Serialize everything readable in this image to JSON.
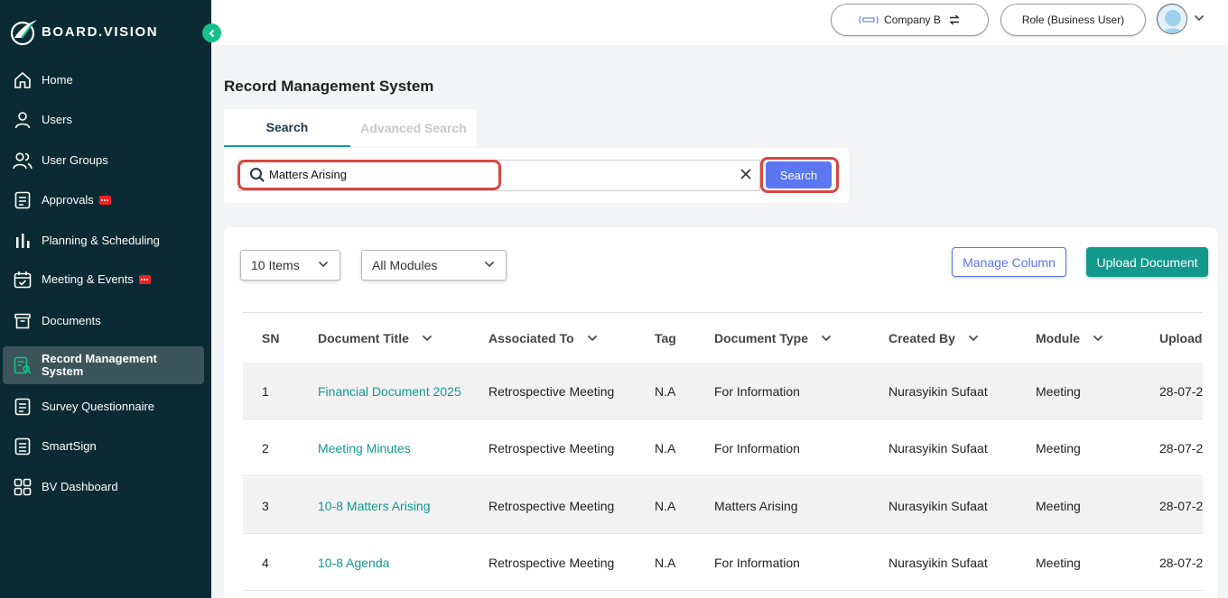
{
  "brand": {
    "name": "BOARD.VISION"
  },
  "sidebar": {
    "items": [
      {
        "label": "Home",
        "icon": "home-icon"
      },
      {
        "label": "Users",
        "icon": "user-icon"
      },
      {
        "label": "User Groups",
        "icon": "user-groups-icon"
      },
      {
        "label": "Approvals",
        "icon": "approvals-icon",
        "badge": true
      },
      {
        "label": "Planning & Scheduling",
        "icon": "bar-chart-icon"
      },
      {
        "label": "Meeting & Events",
        "icon": "calendar-icon",
        "badge": true
      },
      {
        "label": "Documents",
        "icon": "archive-icon"
      },
      {
        "label": "Record Management System",
        "icon": "record-icon",
        "active": true
      },
      {
        "label": "Survey Questionnaire",
        "icon": "survey-icon"
      },
      {
        "label": "SmartSign",
        "icon": "smartsign-icon"
      },
      {
        "label": "BV Dashboard",
        "icon": "dashboard-grid-icon"
      }
    ]
  },
  "topbar": {
    "company_label": "Company B",
    "role_label": "Role (Business User)"
  },
  "page": {
    "title": "Record Management System"
  },
  "tabs": {
    "search": "Search",
    "advanced": "Advanced Search"
  },
  "search": {
    "value": "Matters Arising",
    "button_label": "Search"
  },
  "toolbar": {
    "items_select": "10 Items",
    "modules_select": "All Modules",
    "manage_column": "Manage Column",
    "upload_document": "Upload Document"
  },
  "table": {
    "columns": [
      "SN",
      "Document Title",
      "Associated To",
      "Tag",
      "Document Type",
      "Created By",
      "Module",
      "Upload"
    ],
    "rows": [
      [
        "1",
        "Financial Document 2025",
        "Retrospective Meeting",
        "N.A",
        "For Information",
        "Nurasyikin Sufaat",
        "Meeting",
        "28-07-2"
      ],
      [
        "2",
        "Meeting Minutes",
        "Retrospective Meeting",
        "N.A",
        "For Information",
        "Nurasyikin Sufaat",
        "Meeting",
        "28-07-2"
      ],
      [
        "3",
        "10-8 Matters Arising",
        "Retrospective Meeting",
        "N.A",
        "Matters Arising",
        "Nurasyikin Sufaat",
        "Meeting",
        "28-07-2"
      ],
      [
        "4",
        "10-8 Agenda",
        "Retrospective Meeting",
        "N.A",
        "For Information",
        "Nurasyikin Sufaat",
        "Meeting",
        "28-07-2"
      ]
    ]
  },
  "colors": {
    "sidebar_bg": "#0b2b34",
    "accent_teal": "#12998c",
    "primary_blue": "#5b76f0",
    "highlight_red": "#d8473f"
  }
}
